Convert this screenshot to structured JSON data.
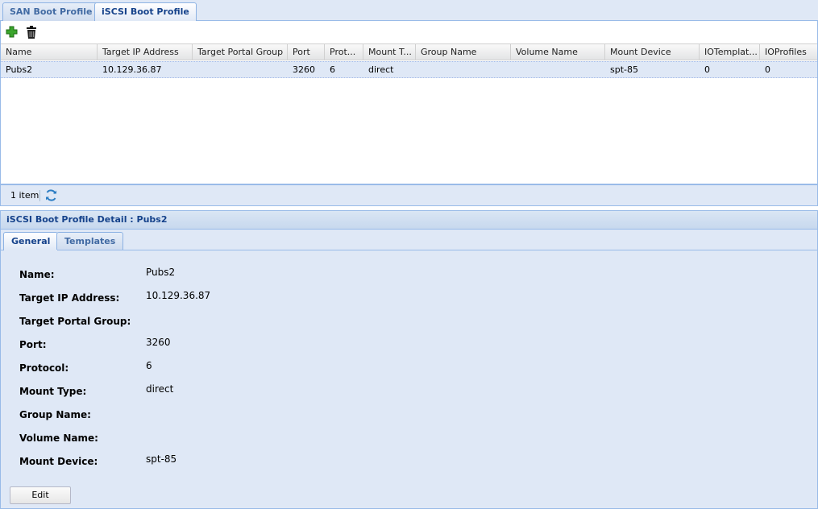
{
  "top_tabs": [
    {
      "label": "SAN Boot Profile",
      "active": false
    },
    {
      "label": "iSCSI Boot Profile",
      "active": true
    }
  ],
  "toolbar": {
    "add_icon": "add-icon",
    "delete_icon": "trash-icon"
  },
  "grid": {
    "columns": [
      "Name",
      "Target IP Address",
      "Target Portal Group",
      "Port",
      "Prot...",
      "Mount T...",
      "Group Name",
      "Volume Name",
      "Mount Device",
      "IOTemplat...",
      "IOProfiles"
    ],
    "rows": [
      [
        "Pubs2",
        "10.129.36.87",
        "",
        "3260",
        "6",
        "direct",
        "",
        "",
        "spt-85",
        "0",
        "0"
      ]
    ]
  },
  "pager": {
    "count": "1 item",
    "refresh_icon": "refresh-icon"
  },
  "detail": {
    "title": "iSCSI Boot Profile Detail : Pubs2",
    "tabs": [
      {
        "label": "General",
        "active": true
      },
      {
        "label": "Templates",
        "active": false
      }
    ],
    "fields": [
      {
        "label": "Name:",
        "value": "Pubs2"
      },
      {
        "label": "Target IP Address:",
        "value": "10.129.36.87"
      },
      {
        "label": "Target Portal Group:",
        "value": ""
      },
      {
        "label": "Port:",
        "value": "3260"
      },
      {
        "label": "Protocol:",
        "value": "6"
      },
      {
        "label": "Mount Type:",
        "value": "direct"
      },
      {
        "label": "Group Name:",
        "value": ""
      },
      {
        "label": "Volume Name:",
        "value": ""
      },
      {
        "label": "Mount Device:",
        "value": "spt-85"
      }
    ],
    "edit_label": "Edit"
  }
}
